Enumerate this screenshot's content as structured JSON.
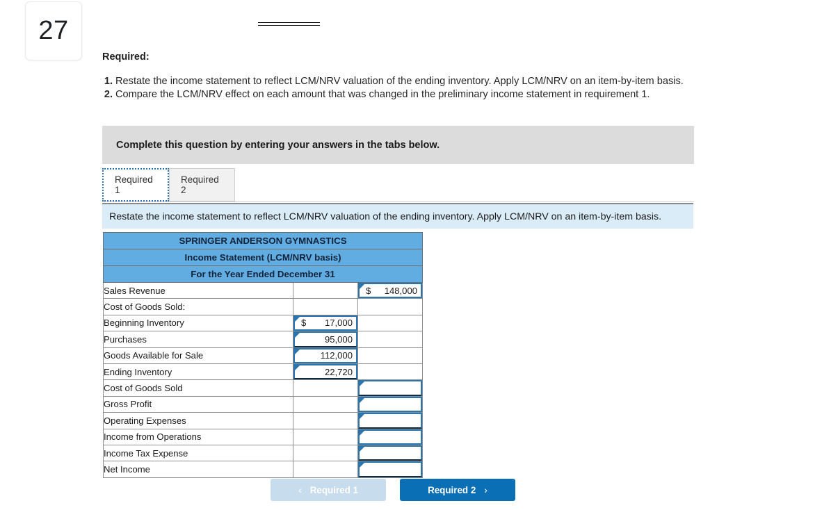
{
  "question_number": "27",
  "required": {
    "heading": "Required:",
    "items": [
      {
        "num": "1.",
        "text": "Restate the income statement to reflect LCM/NRV valuation of the ending inventory. Apply LCM/NRV on an item-by-item basis."
      },
      {
        "num": "2.",
        "text": "Compare the LCM/NRV effect on each amount that was changed in the preliminary income statement in requirement 1."
      }
    ]
  },
  "banner": {
    "text": "Complete this question by entering your answers in the tabs below."
  },
  "tabs": [
    {
      "label": "Required 1",
      "active": true
    },
    {
      "label": "Required 2",
      "active": false
    }
  ],
  "instruction": {
    "text": "Restate the income statement to reflect LCM/NRV valuation of the ending inventory. Apply LCM/NRV on an item-by-item basis."
  },
  "worksheet": {
    "title_rows": [
      "SPRINGER ANDERSON GYMNASTICS",
      "Income Statement (LCM/NRV basis)",
      "For the Year Ended December 31"
    ],
    "rows": [
      {
        "label": "Sales Revenue",
        "indent": 0,
        "mid": null,
        "right": {
          "type": "filled",
          "dollar": "$",
          "value": "148,000",
          "thick_bottom": false
        }
      },
      {
        "label": "Cost of Goods Sold:",
        "indent": 0,
        "mid": null,
        "right": null
      },
      {
        "label": "Beginning Inventory",
        "indent": 1,
        "mid": {
          "type": "filled",
          "dollar": "$",
          "value": "17,000",
          "thick_bottom": false
        },
        "right": null
      },
      {
        "label": "Purchases",
        "indent": 1,
        "mid": {
          "type": "filled",
          "dollar": "",
          "value": "95,000",
          "thick_bottom": true
        },
        "right": null
      },
      {
        "label": "Goods Available for Sale",
        "indent": 2,
        "mid": {
          "type": "filled",
          "dollar": "",
          "value": "112,000",
          "thick_bottom": false
        },
        "right": null
      },
      {
        "label": "Ending Inventory",
        "indent": 1,
        "mid": {
          "type": "filled",
          "dollar": "",
          "value": "22,720",
          "thick_bottom": true
        },
        "right": null
      },
      {
        "label": "Cost of Goods Sold",
        "indent": 2,
        "mid": null,
        "right": {
          "type": "empty",
          "dollar": "",
          "value": "",
          "thick_bottom": true
        }
      },
      {
        "label": "Gross Profit",
        "indent": 0,
        "mid": null,
        "right": {
          "type": "empty",
          "dollar": "",
          "value": "",
          "thick_bottom": false
        }
      },
      {
        "label": "Operating Expenses",
        "indent": 0,
        "mid": null,
        "right": {
          "type": "empty",
          "dollar": "",
          "value": "",
          "thick_bottom": true
        }
      },
      {
        "label": "Income from Operations",
        "indent": 0,
        "mid": null,
        "right": {
          "type": "empty",
          "dollar": "",
          "value": "",
          "thick_bottom": false
        }
      },
      {
        "label": "Income Tax Expense",
        "indent": 0,
        "mid": null,
        "right": {
          "type": "empty",
          "dollar": "",
          "value": "",
          "thick_bottom": true
        }
      },
      {
        "label": "Net Income",
        "indent": 0,
        "mid": null,
        "right": {
          "type": "empty",
          "dollar": "",
          "value": "",
          "thick_bottom": true
        }
      }
    ]
  },
  "nav": {
    "prev_label": "Required 1",
    "prev_icon": "chevron-left-icon",
    "prev_glyph": "‹",
    "next_label": "Required 2",
    "next_icon": "chevron-right-icon",
    "next_glyph": "›"
  },
  "colors": {
    "header_blue": "#61ACE1",
    "instruction_bg": "#d9ecf8",
    "banner_bg": "#dcdcdc",
    "primary_button": "#0b6fb5",
    "disabled_button": "#c7dcec",
    "cell_border": "#2a75ad"
  }
}
